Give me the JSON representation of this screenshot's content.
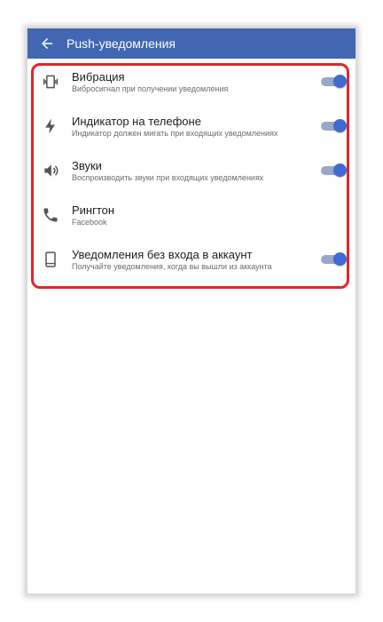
{
  "appbar": {
    "title": "Push-уведомления"
  },
  "settings": [
    {
      "title": "Вибрация",
      "subtitle": "Вибросигнал при получении уведомления",
      "icon": "vibration-icon",
      "toggle": true
    },
    {
      "title": "Индикатор на телефоне",
      "subtitle": "Индикатор должен мигать при входящих уведомлениях",
      "icon": "flash-icon",
      "toggle": true
    },
    {
      "title": "Звуки",
      "subtitle": "Воспроизводить звуки при входящих уведомлениях",
      "icon": "volume-icon",
      "toggle": true
    },
    {
      "title": "Рингтон",
      "subtitle": "Facebook",
      "icon": "phone-icon",
      "toggle": null
    },
    {
      "title": "Уведомления без входа в аккаунт",
      "subtitle": "Получайте уведомления, когда вы вышли из аккаунта",
      "icon": "smartphone-icon",
      "toggle": true
    }
  ],
  "colors": {
    "appbar": "#4267b2",
    "toggle_on": "#3f6ad3",
    "highlight": "#e4252b"
  }
}
